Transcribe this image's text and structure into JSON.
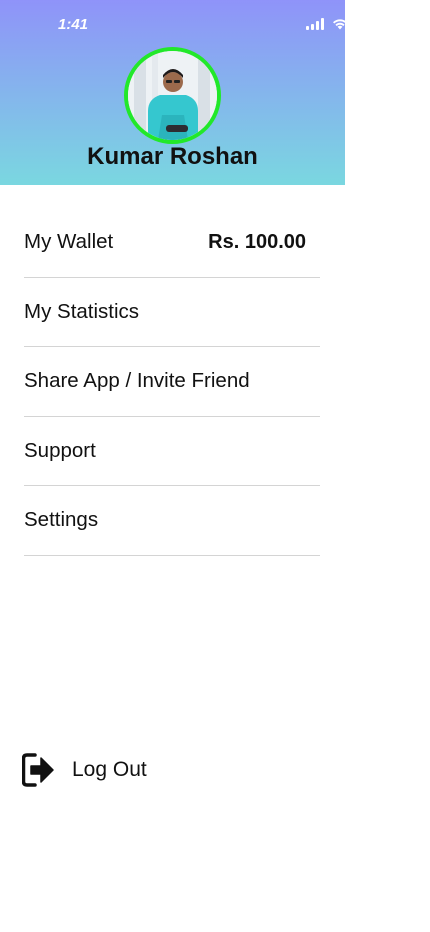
{
  "status_bar": {
    "time": "1:41",
    "icons": [
      "signal-icon",
      "wifi-icon"
    ]
  },
  "profile": {
    "name": "Kumar Roshan",
    "avatar": "profile-photo",
    "ring_color": "#22e82a"
  },
  "header": {
    "gradient_top": "#8f93f9",
    "gradient_bottom": "#7ad7e0"
  },
  "menu": {
    "items": [
      {
        "label": "My Wallet",
        "value": "Rs. 100.00"
      },
      {
        "label": "My Statistics"
      },
      {
        "label": "Share App / Invite Friend"
      },
      {
        "label": "Support"
      },
      {
        "label": "Settings"
      }
    ]
  },
  "logout": {
    "label": "Log Out",
    "icon": "logout-icon"
  }
}
